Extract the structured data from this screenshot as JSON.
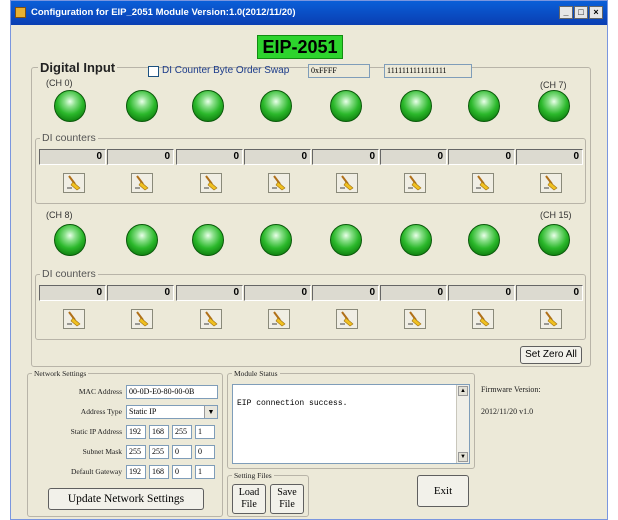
{
  "window": {
    "title": "Configuration for EIP_2051 Module Version:1.0(2012/11/20)",
    "controls": [
      "_",
      "□",
      "×"
    ]
  },
  "header": {
    "model": "EIP-2051",
    "color": "#2dd42d"
  },
  "digital_input": {
    "title": "Digital Input",
    "swap_label": "DI Counter Byte Order Swap",
    "swap_checked": false,
    "hex_value": "0xFFFF",
    "binary_value": "1111111111111111",
    "row1": {
      "first": "(CH 0)",
      "last": "(CH 7)"
    },
    "row2": {
      "first": "(CH 8)",
      "last": "(CH 15)"
    },
    "counters_label": "DI counters",
    "counters_row1": [
      "0",
      "0",
      "0",
      "0",
      "0",
      "0",
      "0",
      "0"
    ],
    "counters_row2": [
      "0",
      "0",
      "0",
      "0",
      "0",
      "0",
      "0",
      "0"
    ],
    "led_state": "on",
    "led_color": "#2bb82b",
    "clear_icon": "broom-icon",
    "set_zero_all_label": "Set Zero All"
  },
  "network": {
    "title": "Network Settings",
    "mac_label": "MAC Address",
    "mac_value": "00-0D-E0-80-00-0B",
    "address_type_label": "Address Type",
    "address_type_value": "Static IP",
    "ip_label": "Static IP Address",
    "ip": [
      "192",
      "168",
      "255",
      "1"
    ],
    "mask_label": "Subnet Mask",
    "mask": [
      "255",
      "255",
      "0",
      "0"
    ],
    "gateway_label": "Default Gateway",
    "gateway": [
      "192",
      "168",
      "0",
      "1"
    ],
    "update_label": "Update Network Settings"
  },
  "module_status": {
    "title": "Module Status",
    "message": "EIP connection success."
  },
  "setting_files": {
    "title": "Setting Files",
    "load_line1": "Load",
    "load_line2": "File",
    "save_line1": "Save",
    "save_line2": "File"
  },
  "firmware": {
    "label": "Firmware Version:",
    "value": "2012/11/20 v1.0"
  },
  "exit_label": "Exit"
}
